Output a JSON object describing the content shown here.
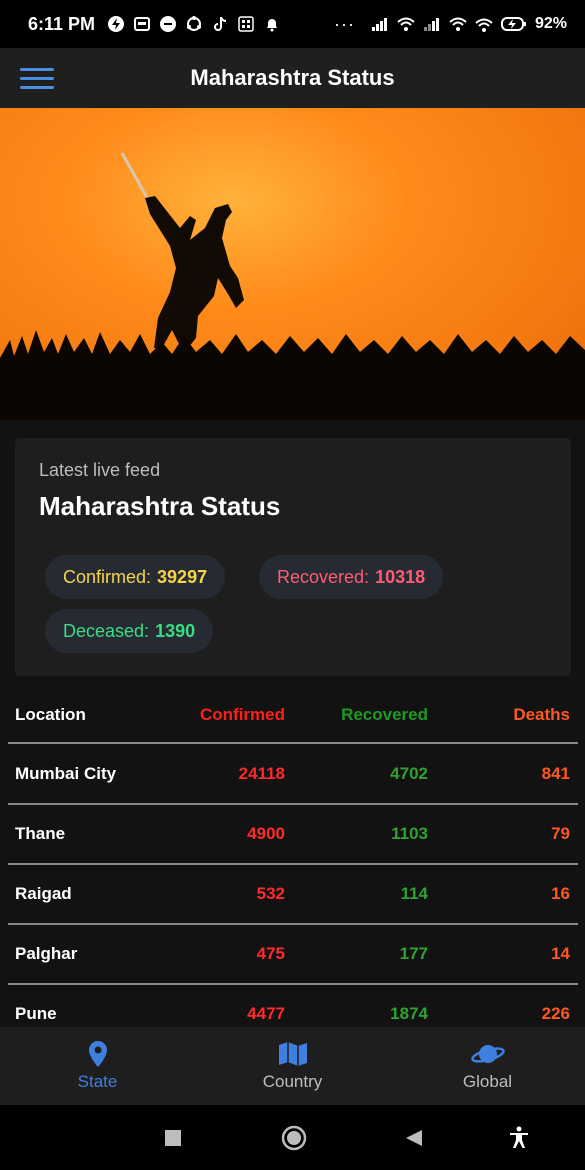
{
  "status_bar": {
    "time": "6:11 PM",
    "dots": "···",
    "battery": "92%"
  },
  "app_bar": {
    "title": "Maharashtra Status"
  },
  "card": {
    "subtitle": "Latest live feed",
    "heading": "Maharashtra Status",
    "confirmed_label": "Confirmed:",
    "confirmed_value": "39297",
    "recovered_label": "Recovered:",
    "recovered_value": "10318",
    "deceased_label": "Deceased:",
    "deceased_value": "1390"
  },
  "table": {
    "headers": {
      "location": "Location",
      "confirmed": "Confirmed",
      "recovered": "Recovered",
      "deaths": "Deaths"
    },
    "rows": [
      {
        "location": "Mumbai City",
        "confirmed": "24118",
        "recovered": "4702",
        "deaths": "841"
      },
      {
        "location": "Thane",
        "confirmed": "4900",
        "recovered": "1103",
        "deaths": "79"
      },
      {
        "location": "Raigad",
        "confirmed": "532",
        "recovered": "114",
        "deaths": "16"
      },
      {
        "location": "Palghar",
        "confirmed": "475",
        "recovered": "177",
        "deaths": "14"
      },
      {
        "location": "Pune",
        "confirmed": "4477",
        "recovered": "1874",
        "deaths": "226"
      }
    ]
  },
  "bottom_nav": {
    "items": [
      {
        "label": "State",
        "icon": "location-pin-icon",
        "active": true
      },
      {
        "label": "Country",
        "icon": "map-icon",
        "active": false
      },
      {
        "label": "Global",
        "icon": "planet-icon",
        "active": false
      }
    ]
  },
  "colors": {
    "accent": "#3f7fe0",
    "confirmed": "#ff2a2a",
    "recovered": "#2fa32f",
    "deaths": "#ff5722",
    "chip_confirmed": "#f5d547",
    "chip_recovered": "#ff5c73",
    "chip_deceased": "#3ddc84"
  }
}
